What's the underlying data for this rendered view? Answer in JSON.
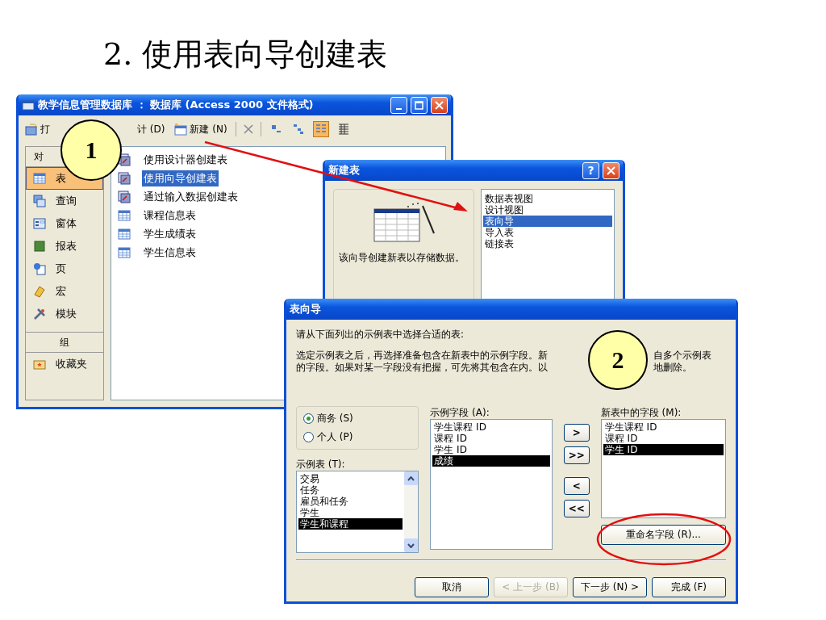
{
  "slide_title": "2.  使用表向导创建表",
  "database_window": {
    "title": "教学信息管理数据库 ： 数据库 (Access 2000 文件格式)",
    "toolbar": [
      {
        "kind": "open",
        "label": "打"
      },
      {
        "kind": "design",
        "label": "计 (D)"
      },
      {
        "kind": "new",
        "label": "新建 (N)"
      }
    ],
    "view_buttons": [
      {
        "kind": "large",
        "selected": false
      },
      {
        "kind": "small",
        "selected": false
      },
      {
        "kind": "list",
        "selected": true
      },
      {
        "kind": "details",
        "selected": false
      }
    ],
    "objects_header": "对",
    "objects": [
      {
        "kind": "table",
        "label": "表",
        "selected": true
      },
      {
        "kind": "query",
        "label": "查询",
        "selected": false
      },
      {
        "kind": "form",
        "label": "窗体",
        "selected": false
      },
      {
        "kind": "report",
        "label": "报表",
        "selected": false
      },
      {
        "kind": "page",
        "label": "页",
        "selected": false
      },
      {
        "kind": "macro",
        "label": "宏",
        "selected": false
      },
      {
        "kind": "module",
        "label": "模块",
        "selected": false
      }
    ],
    "groups_header": "组",
    "groups": [
      {
        "kind": "favorites",
        "label": "收藏夹",
        "selected": false
      }
    ],
    "items": [
      {
        "kind": "shortcut",
        "label": "使用设计器创建表",
        "selected": false
      },
      {
        "kind": "shortcut",
        "label": "使用向导创建表",
        "selected": true
      },
      {
        "kind": "shortcut",
        "label": "通过输入数据创建表",
        "selected": false
      },
      {
        "kind": "table",
        "label": "课程信息表",
        "selected": false
      },
      {
        "kind": "table",
        "label": "学生成绩表",
        "selected": false
      },
      {
        "kind": "table",
        "label": "学生信息表",
        "selected": false
      }
    ]
  },
  "new_table_dialog": {
    "title": "新建表",
    "help_button": "?",
    "description": "该向导创建新表以存储数据。",
    "options": [
      {
        "label": "数据表视图",
        "selected": false
      },
      {
        "label": "设计视图",
        "selected": false
      },
      {
        "label": "表向导",
        "selected": true
      },
      {
        "label": "导入表",
        "selected": false
      },
      {
        "label": "链接表",
        "selected": false
      }
    ]
  },
  "table_wizard": {
    "title": "表向导",
    "instruction": "请从下面列出的示例表中选择合适的表:",
    "description_lines": [
      {
        "left": "选定示例表之后，再选择准备包含在新表中的示例字段。新",
        "right": "自多个示例表"
      },
      {
        "left": "的字段。如果对某一字段没有把握，可先将其包含在内。以",
        "right": "地删除。"
      }
    ],
    "categories": [
      {
        "label": "商务 (S)",
        "selected": true
      },
      {
        "label": "个人 (P)",
        "selected": false
      }
    ],
    "sample_tables_label": "示例表 (T):",
    "sample_tables": [
      {
        "label": "交易",
        "selected": false
      },
      {
        "label": "任务",
        "selected": false
      },
      {
        "label": "雇员和任务",
        "selected": false
      },
      {
        "label": "学生",
        "selected": false
      },
      {
        "label": "学生和课程",
        "selected": true
      }
    ],
    "sample_fields_label": "示例字段 (A):",
    "sample_fields": [
      {
        "label": "学生课程 ID",
        "selected": false
      },
      {
        "label": "课程 ID",
        "selected": false
      },
      {
        "label": "学生 ID",
        "selected": false
      },
      {
        "label": "成绩",
        "selected": true
      }
    ],
    "move_buttons": [
      ">",
      ">>",
      "<",
      "<<"
    ],
    "new_fields_label": "新表中的字段 (M):",
    "new_fields": [
      {
        "label": "学生课程 ID",
        "selected": false
      },
      {
        "label": "课程 ID",
        "selected": false
      },
      {
        "label": "学生 ID",
        "selected": true
      }
    ],
    "rename_button": "重命名字段 (R)...",
    "buttons": [
      {
        "label": "取消",
        "disabled": false
      },
      {
        "label": "< 上一步 (B)",
        "disabled": true
      },
      {
        "label": "下一步 (N) >",
        "disabled": false
      },
      {
        "label": "完成 (F)",
        "disabled": false
      }
    ]
  },
  "callouts": [
    {
      "label": "1"
    },
    {
      "label": "2"
    }
  ]
}
